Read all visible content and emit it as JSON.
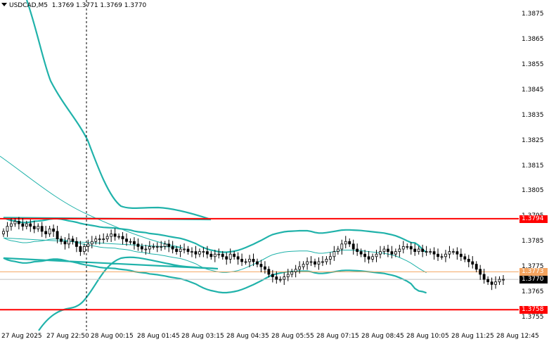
{
  "header": {
    "symbol": "USDCAD,M5",
    "ohlc": "1.3769 1.3771 1.3769 1.3770"
  },
  "colors": {
    "background": "#ffffff",
    "candle": "#000000",
    "bollinger": "#20b2aa",
    "level_line": "#ff0000",
    "current_line": "#f4a460",
    "grid": "#c0c0c0"
  },
  "chart_data": {
    "type": "candlestick",
    "symbol": "USDCAD",
    "timeframe": "M5",
    "ylim": [
      1.3749,
      1.3885
    ],
    "y_ticks": [
      "1.3875",
      "1.3865",
      "1.3855",
      "1.3845",
      "1.3835",
      "1.3825",
      "1.3815",
      "1.3805",
      "1.3795",
      "1.3785",
      "1.3775",
      "1.3765",
      "1.3755"
    ],
    "x_ticks": [
      "27 Aug 2025",
      "27 Aug 22:50",
      "28 Aug 00:15",
      "28 Aug 01:45",
      "28 Aug 03:15",
      "28 Aug 04:35",
      "28 Aug 05:55",
      "28 Aug 07:15",
      "28 Aug 08:45",
      "28 Aug 10:05",
      "28 Aug 11:25",
      "28 Aug 12:45"
    ],
    "horizontal_levels": [
      {
        "label": "1.3794",
        "value": 1.3794,
        "color": "#ff0000"
      },
      {
        "label": "1.3758",
        "value": 1.3758,
        "color": "#ff0000"
      }
    ],
    "current_price": {
      "label": "1.3773",
      "value": 1.3773
    },
    "last_close": {
      "label": "1.3770",
      "value": 1.377
    },
    "vertical_marker_x_label": "27 Aug 22:50",
    "close_series": [
      1.3789,
      1.3791,
      1.3792,
      1.3793,
      1.3792,
      1.3791,
      1.3792,
      1.3791,
      1.379,
      1.3791,
      1.3789,
      1.3788,
      1.379,
      1.3789,
      1.3786,
      1.3785,
      1.3784,
      1.3786,
      1.3785,
      1.3783,
      1.3781,
      1.3783,
      1.3784,
      1.3785,
      1.3786,
      1.3786,
      1.3786,
      1.3787,
      1.3788,
      1.3787,
      1.3787,
      1.3786,
      1.3785,
      1.3785,
      1.3784,
      1.3783,
      1.3782,
      1.3782,
      1.3783,
      1.3783,
      1.3783,
      1.3783,
      1.3784,
      1.3783,
      1.3782,
      1.3781,
      1.3782,
      1.3782,
      1.3781,
      1.3781,
      1.378,
      1.3781,
      1.3781,
      1.378,
      1.3779,
      1.378,
      1.378,
      1.3779,
      1.3778,
      1.378,
      1.3779,
      1.3778,
      1.3777,
      1.3777,
      1.3778,
      1.3777,
      1.3776,
      1.3775,
      1.3774,
      1.3772,
      1.3771,
      1.377,
      1.377,
      1.3771,
      1.3772,
      1.3773,
      1.3774,
      1.3775,
      1.3776,
      1.3777,
      1.3777,
      1.3776,
      1.3777,
      1.3777,
      1.3778,
      1.3779,
      1.3781,
      1.3782,
      1.3784,
      1.3785,
      1.3784,
      1.3782,
      1.3781,
      1.378,
      1.3779,
      1.3778,
      1.3779,
      1.378,
      1.3781,
      1.3782,
      1.3781,
      1.378,
      1.3781,
      1.3782,
      1.3783,
      1.3783,
      1.3782,
      1.3781,
      1.3782,
      1.3781,
      1.3781,
      1.3781,
      1.378,
      1.3779,
      1.3779,
      1.378,
      1.3781,
      1.3781,
      1.378,
      1.3779,
      1.3778,
      1.3777,
      1.3776,
      1.3774,
      1.3772,
      1.377,
      1.3769,
      1.3768,
      1.3769,
      1.377,
      1.377
    ]
  }
}
